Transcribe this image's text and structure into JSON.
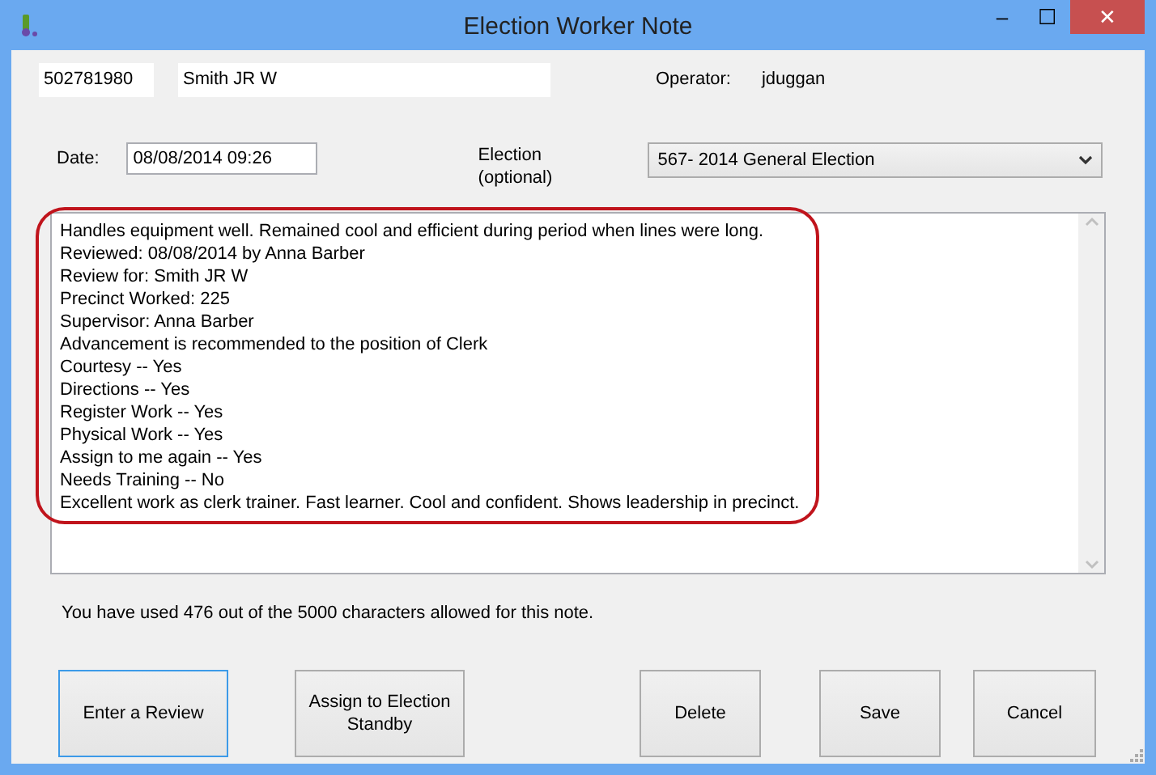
{
  "window": {
    "title": "Election Worker Note",
    "controls": [
      "‒",
      "☐",
      "✕"
    ]
  },
  "worker": {
    "id": "502781980",
    "name": "Smith JR W"
  },
  "operator": {
    "label": "Operator:",
    "value": "jduggan"
  },
  "date": {
    "label": "Date:",
    "value": "08/08/2014 09:26"
  },
  "election": {
    "label": "Election (optional)",
    "value": "567- 2014 General Election"
  },
  "note": {
    "highlighted": true,
    "lines": [
      "Handles equipment well. Remained cool and efficient during period when lines were long.",
      "Reviewed: 08/08/2014 by Anna Barber",
      "Review for: Smith JR W",
      "Precinct Worked: 225",
      "Supervisor: Anna Barber",
      "Advancement is recommended to the position of Clerk",
      "Courtesy -- Yes",
      "Directions -- Yes",
      "Register Work -- Yes",
      "Physical Work -- Yes",
      "Assign to me again -- Yes",
      "Needs Training -- No",
      "Excellent work as clerk trainer. Fast learner. Cool and confident. Shows leadership in precinct."
    ]
  },
  "usage": "You have used 476 out of the 5000 characters allowed for this note.",
  "buttons": [
    {
      "label": "Enter a Review",
      "focused": true
    },
    {
      "label": "Assign to Election Standby",
      "focused": false
    },
    {
      "label": "Delete",
      "focused": false
    },
    {
      "label": "Save",
      "focused": false
    },
    {
      "label": "Cancel",
      "focused": false
    }
  ]
}
